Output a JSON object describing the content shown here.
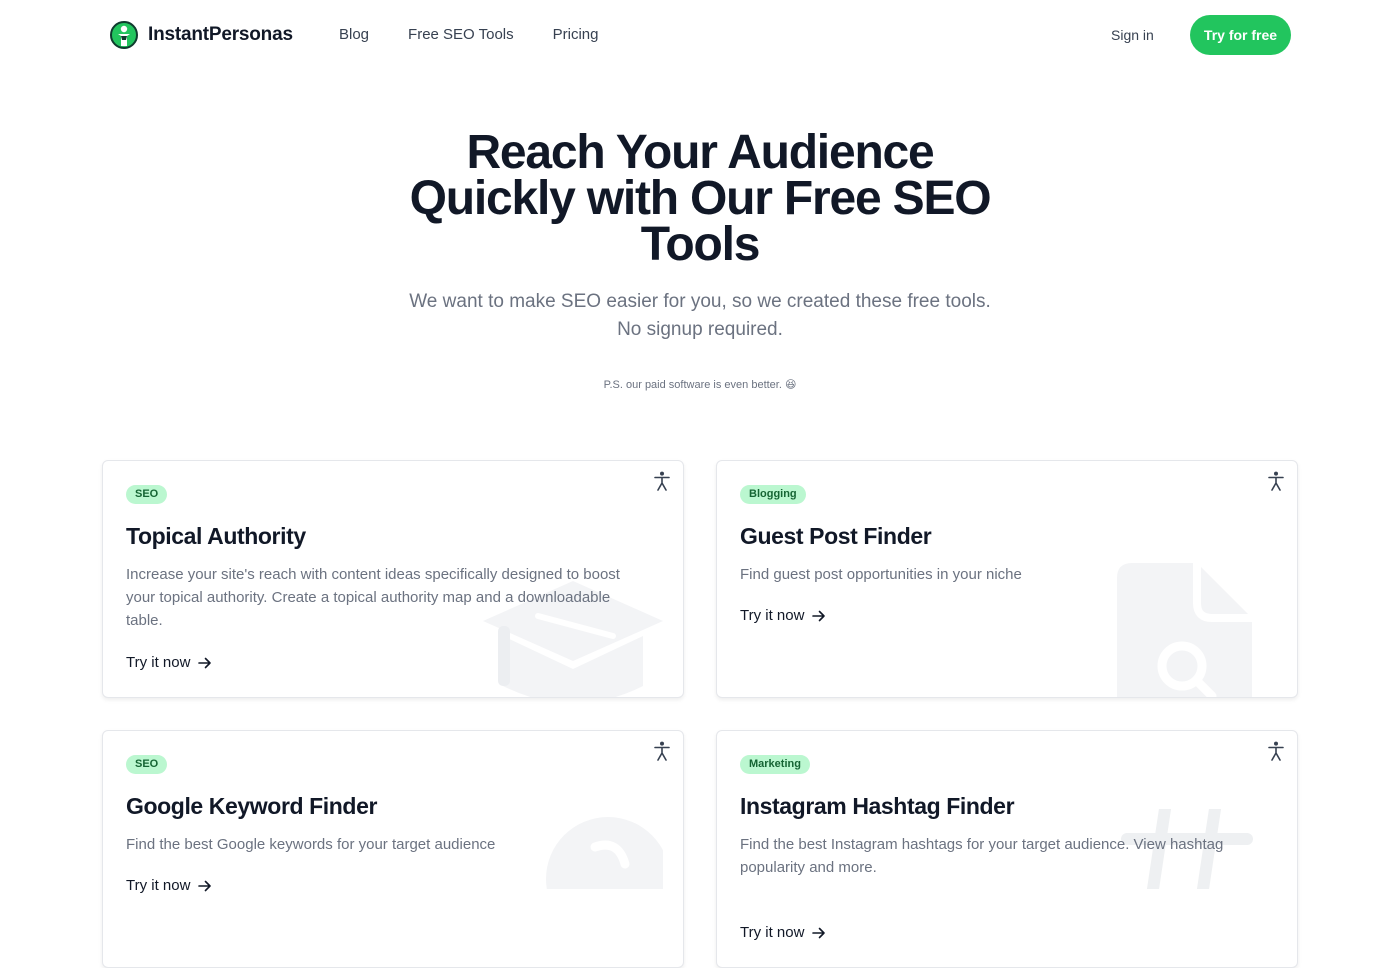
{
  "header": {
    "brand": "InstantPersonas",
    "nav": [
      "Blog",
      "Free SEO Tools",
      "Pricing"
    ],
    "signin": "Sign in",
    "cta": "Try for free"
  },
  "hero": {
    "title": "Reach Your Audience Quickly with Our Free SEO Tools",
    "subtitle_line1": "We want to make SEO easier for you, so we created these free tools.",
    "subtitle_line2": "No signup required.",
    "ps": "P.S. our paid software is even better. 😆"
  },
  "cards": [
    {
      "tag": "SEO",
      "title": "Topical Authority",
      "description": "Increase your site's reach with content ideas specifically designed to boost your topical authority. Create a topical authority map and a downloadable table.",
      "cta": "Try it now"
    },
    {
      "tag": "Blogging",
      "title": "Guest Post Finder",
      "description": "Find guest post opportunities in your niche",
      "cta": "Try it now"
    },
    {
      "tag": "SEO",
      "title": "Google Keyword Finder",
      "description": "Find the best Google keywords for your target audience",
      "cta": "Try it now"
    },
    {
      "tag": "Marketing",
      "title": "Instagram Hashtag Finder",
      "description": "Find the best Instagram hashtags for your target audience. View hashtag popularity and more.",
      "cta": "Try it now"
    }
  ],
  "icons": {
    "logo": "person-logo-icon",
    "card_corner": "accessibility-icon",
    "cta_arrow": "arrow-right-icon",
    "card_backgrounds": [
      "graduation-cap-icon",
      "file-search-icon",
      "phone-icon",
      "hashtag-icon"
    ]
  },
  "colors": {
    "accent": "#22c55e",
    "badge_bg": "#bbf7d0",
    "badge_text": "#166534",
    "heading": "#111827",
    "muted": "#6b7280"
  }
}
